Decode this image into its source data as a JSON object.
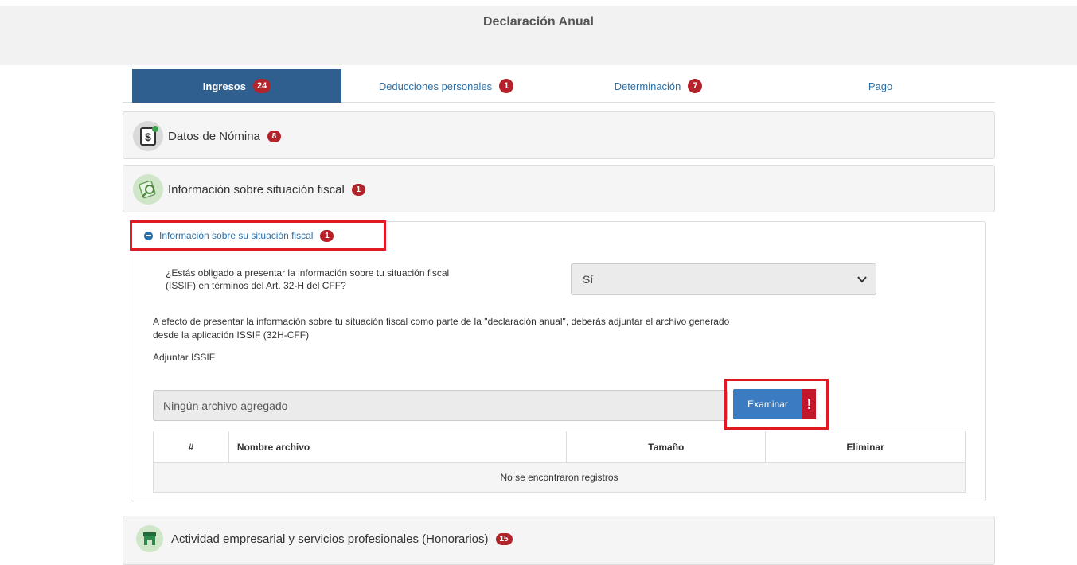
{
  "header": {
    "title": "Declaración Anual"
  },
  "tabs": [
    {
      "label": "Ingresos",
      "badge": "24"
    },
    {
      "label": "Deducciones personales",
      "badge": "1"
    },
    {
      "label": "Determinación",
      "badge": "7"
    },
    {
      "label": "Pago",
      "badge": ""
    }
  ],
  "sections": {
    "nomina": {
      "title": "Datos de Nómina",
      "badge": "8",
      "icon": "dollar-document-icon"
    },
    "fiscal": {
      "title": "Información sobre situación fiscal",
      "badge": "1",
      "icon": "magnifier-document-icon"
    },
    "actividad": {
      "title": "Actividad empresarial y servicios profesionales (Honorarios)",
      "badge": "15",
      "icon": "storefront-icon"
    }
  },
  "subsection": {
    "title": "Información sobre su situación fiscal",
    "badge": "1",
    "question": "¿Estás obligado a presentar la información sobre tu situación fiscal (ISSIF) en términos del Art. 32-H del CFF?",
    "select_value": "Sí",
    "paragraph": "A efecto de presentar la información sobre tu situación fiscal como parte de la \"declaración anual\", deberás adjuntar el archivo generado desde la aplicación ISSIF (32H-CFF)",
    "attach_label": "Adjuntar ISSIF",
    "file_placeholder": "Ningún archivo agregado",
    "browse_label": "Examinar",
    "alert_glyph": "!"
  },
  "table": {
    "headers": [
      "#",
      "Nombre archivo",
      "Tamaño",
      "Eliminar"
    ],
    "empty_message": "No se encontraron registros"
  },
  "colors": {
    "accent": "#2f5f8e",
    "badge": "#b5232a",
    "highlight": "#e01a22",
    "button": "#3a7bc1"
  }
}
